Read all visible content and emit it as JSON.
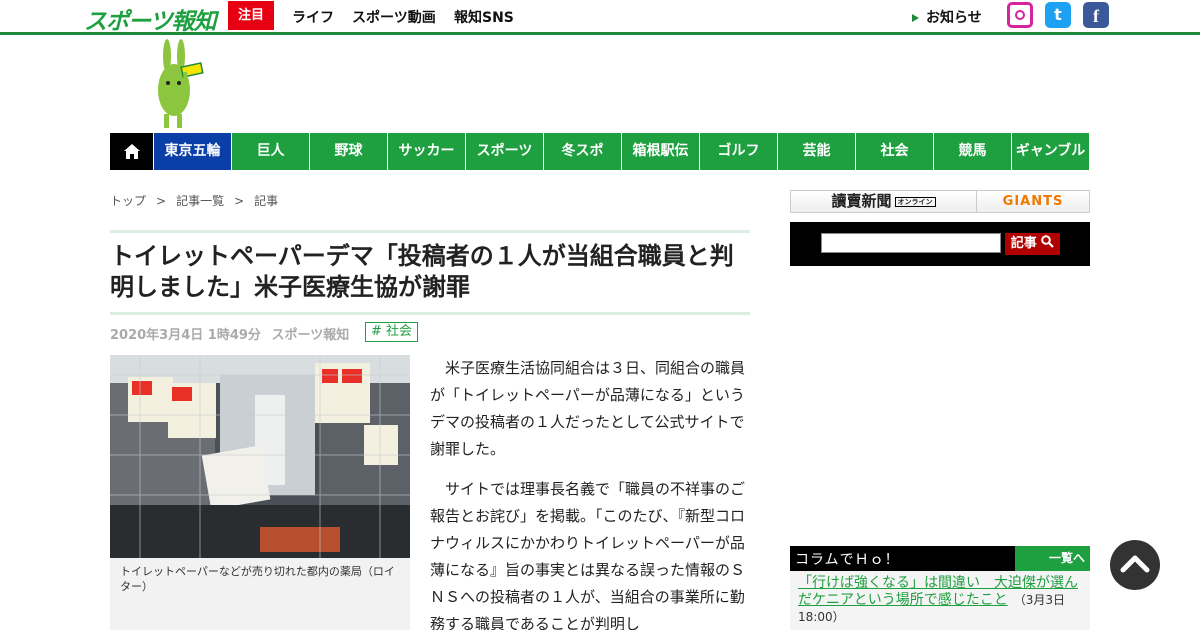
{
  "header": {
    "logo": "スポーツ報知",
    "attention": "注目",
    "links": [
      "ライフ",
      "スポーツ動画",
      "報知SNS"
    ],
    "notice": "お知らせ",
    "sns": {
      "twitter_glyph": "t",
      "facebook_glyph": "f"
    }
  },
  "nav": {
    "items": [
      "東京五輪",
      "巨人",
      "野球",
      "サッカー",
      "スポーツ",
      "冬スポ",
      "箱根駅伝",
      "ゴルフ",
      "芸能",
      "社会",
      "競馬",
      "ギャンブル"
    ]
  },
  "breadcrumb": [
    "トップ",
    "記事一覧",
    "記事"
  ],
  "article": {
    "headline": "トイレットペーパーデマ「投稿者の１人が当組合職員と判明しました」米子医療生協が謝罪",
    "date": "2020年3月4日 1時49分",
    "source": "スポーツ報知",
    "tag": "# 社会",
    "caption": "トイレットペーパーなどが売り切れた都内の薬局（ロイター）",
    "paragraphs": [
      "米子医療生活協同組合は３日、同組合の職員が「トイレットペーパーが品薄になる」というデマの投稿者の１人だったとして公式サイトで謝罪した。",
      "サイトでは理事長名義で「職員の不祥事のご報告とお詫び」を掲載。「このたび、『新型コロナウィルスにかかわりトイレットペーパーが品薄になる』旨の事実とは異なる誤った情報のＳＮＳへの投稿者の１人が、当組合の事業所に勤務する職員であることが判明し"
    ]
  },
  "sidebar": {
    "yomiuri": "讀賣新聞",
    "yomiuri_badge": "オンライン",
    "giants": "GIANTS",
    "search_placeholder": "",
    "search_button": "記事",
    "column_title": "コラムでＨｏ！",
    "column_all": "一覧へ",
    "column_link": "「行けば強くなる」は間違い　大迫傑が選んだケニアという場所で感じたこと",
    "column_date": "（3月3日 18:00）"
  }
}
